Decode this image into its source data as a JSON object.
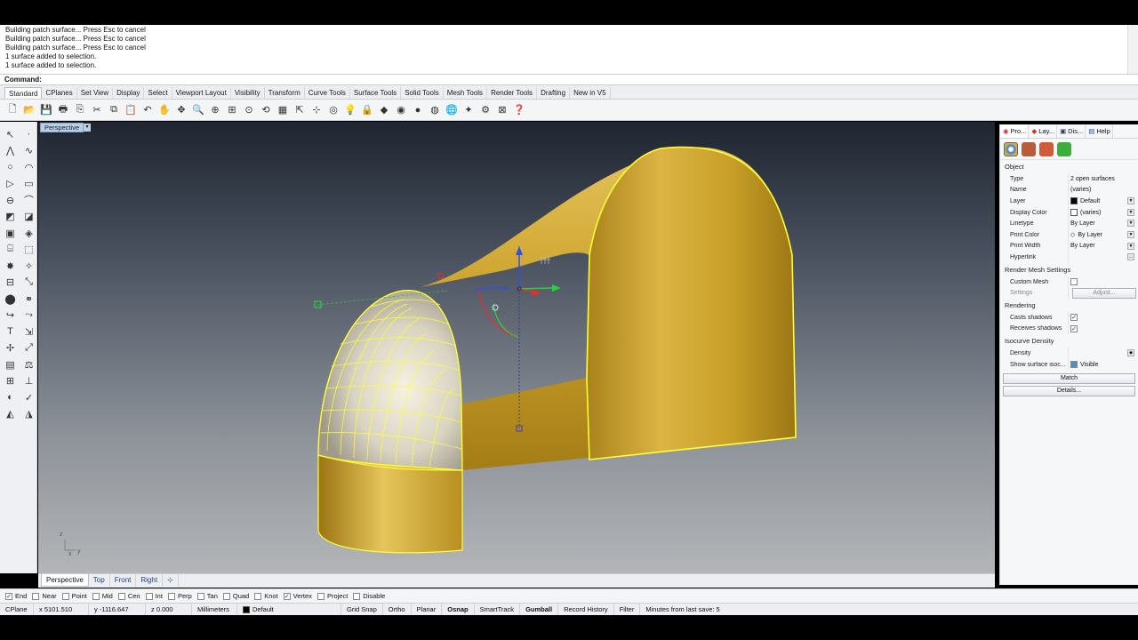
{
  "history": {
    "lines": [
      "Building patch surface... Press Esc to cancel",
      "Building patch surface... Press Esc to cancel",
      "Building patch surface... Press Esc to cancel",
      "1 surface added to selection.",
      "1 surface added to selection."
    ]
  },
  "command": {
    "label": "Command:"
  },
  "tabs": [
    "Standard",
    "CPlanes",
    "Set View",
    "Display",
    "Select",
    "Viewport Layout",
    "Visibility",
    "Transform",
    "Curve Tools",
    "Surface Tools",
    "Solid Tools",
    "Mesh Tools",
    "Render Tools",
    "Drafting",
    "New in V5"
  ],
  "viewport": {
    "label": "Perspective",
    "tabs": [
      "Perspective",
      "Top",
      "Front",
      "Right"
    ],
    "axis": {
      "z": "z",
      "x": "x",
      "y": "y"
    }
  },
  "panel": {
    "tabs": [
      "Pro...",
      "Lay...",
      "Dis...",
      "Help"
    ],
    "section_object": "Object",
    "rows": [
      {
        "k": "Type",
        "v": "2 open surfaces"
      },
      {
        "k": "Name",
        "v": "(varies)"
      },
      {
        "k": "Layer",
        "v": "Default"
      },
      {
        "k": "Display Color",
        "v": "(varies)"
      },
      {
        "k": "Linetype",
        "v": "By Layer"
      },
      {
        "k": "Print Color",
        "v": "By Layer"
      },
      {
        "k": "Print Width",
        "v": "By Layer"
      },
      {
        "k": "Hyperlink",
        "v": ""
      }
    ],
    "section_render_mesh": "Render Mesh Settings",
    "custom_mesh": "Custom Mesh",
    "settings": "Settings",
    "adjust": "Adjust...",
    "section_rendering": "Rendering",
    "casts_shadows": "Casts shadows",
    "receives_shadows": "Receives shadows",
    "section_isocurve": "Isocurve Density",
    "density": "Density",
    "show_iso": "Show surface isoc...",
    "visible": "Visible",
    "match": "Match",
    "details": "Details..."
  },
  "osnaps": [
    {
      "label": "End",
      "checked": true
    },
    {
      "label": "Near",
      "checked": false
    },
    {
      "label": "Point",
      "checked": false
    },
    {
      "label": "Mid",
      "checked": false
    },
    {
      "label": "Cen",
      "checked": false
    },
    {
      "label": "Int",
      "checked": false
    },
    {
      "label": "Perp",
      "checked": false
    },
    {
      "label": "Tan",
      "checked": false
    },
    {
      "label": "Quad",
      "checked": false
    },
    {
      "label": "Knot",
      "checked": false
    },
    {
      "label": "Vertex",
      "checked": true
    },
    {
      "label": "Project",
      "checked": false
    },
    {
      "label": "Disable",
      "checked": false
    }
  ],
  "status": {
    "cplane": "CPlane",
    "x": "x 5101.510",
    "y": "y -1116.647",
    "z": "z 0.000",
    "units": "Millimeters",
    "layer": "Default",
    "grid_snap": "Grid Snap",
    "ortho": "Ortho",
    "planar": "Planar",
    "osnap": "Osnap",
    "smarttrack": "SmartTrack",
    "gumball": "Gumball",
    "record_history": "Record History",
    "filter": "Filter",
    "last_save": "Minutes from last save: 5"
  },
  "colors": {
    "surface": "#d4a92a",
    "selection": "#ffff33",
    "accent": "#1a3f8a"
  }
}
